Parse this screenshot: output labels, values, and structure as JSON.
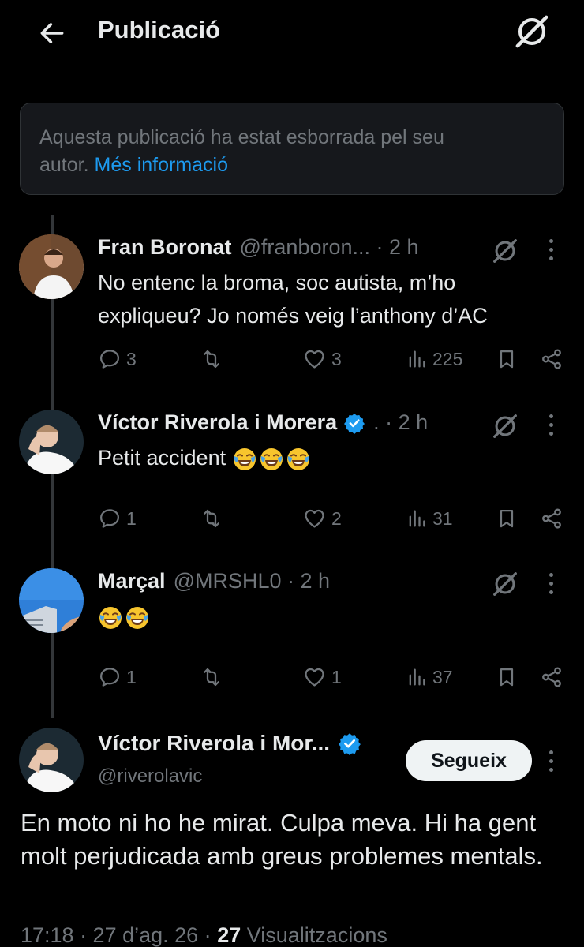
{
  "header": {
    "title": "Publicació",
    "back_icon": "arrow-left-icon",
    "grok_icon": "grok-icon"
  },
  "deleted_notice": {
    "text": "Aquesta publicació ha estat esborrada pel seu",
    "text_line2": "autor.",
    "link": "Més informació"
  },
  "replies": [
    {
      "name": "Fran Boronat",
      "handle": "@franboron...",
      "time": "· 2 h",
      "verified": false,
      "text_lines": [
        "No entenc la broma, soc autista, m’ho",
        "expliqueu? Jo només veig l’anthony d’AC"
      ],
      "replies": "3",
      "reposts": "",
      "likes": "3",
      "views": "225"
    },
    {
      "name": "Víctor Riverola i Morera",
      "handle": ".",
      "time": "· 2 h",
      "verified": true,
      "text": "Petit accident",
      "emoji": [
        "face-with-tears-of-joy",
        "face-with-tears-of-joy",
        "face-with-tears-of-joy"
      ],
      "replies": "1",
      "reposts": "",
      "likes": "2",
      "views": "31"
    },
    {
      "name": "Marçal",
      "handle": "@MRSHL0",
      "time": "· 2 h",
      "verified": false,
      "text": "",
      "emoji": [
        "face-with-tears-of-joy",
        "face-with-tears-of-joy"
      ],
      "replies": "1",
      "reposts": "",
      "likes": "1",
      "views": "37"
    }
  ],
  "main_post": {
    "name": "Víctor Riverola i Mor...",
    "handle": "@riverolavic",
    "verified": true,
    "follow_label": "Segueix",
    "text": "En moto ni ho he mirat. Culpa meva. Hi ha gent molt perjudicada amb greus problemes mentals.",
    "timestamp": "17:18 · 27 d’ag. 26 ·",
    "views_count": "27",
    "views_label": "Visualitzacions"
  },
  "colors": {
    "background": "#000000",
    "text": "#e7e9ea",
    "muted": "#71767b",
    "accent": "#1d9bf0",
    "border": "#2f3336"
  }
}
